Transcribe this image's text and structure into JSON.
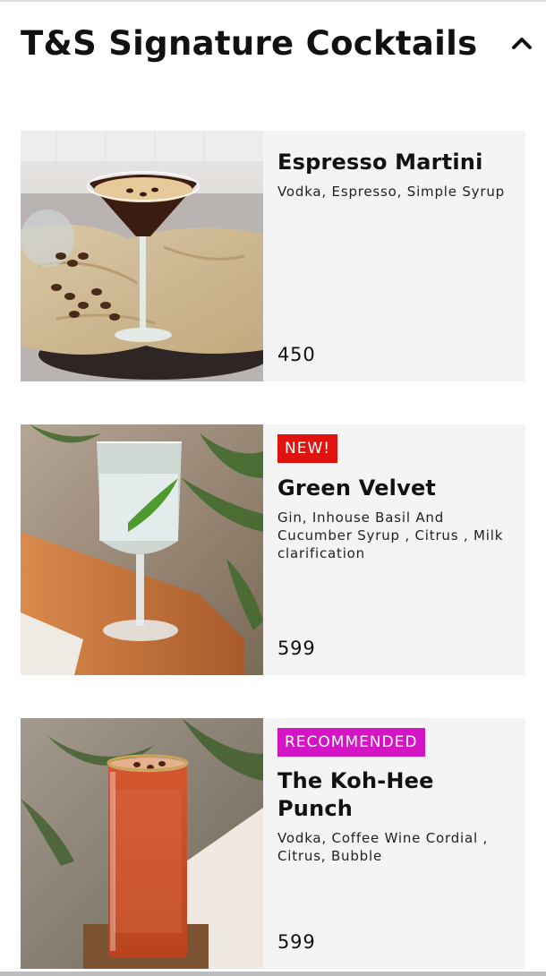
{
  "section": {
    "title": "T&S Signature Cocktails",
    "collapse_icon": "chevron-up-icon"
  },
  "items": [
    {
      "name": "Espresso Martini",
      "description": "Vodka, Espresso, Simple Syrup",
      "price": "450",
      "badge": "",
      "image": "espresso-martini-photo"
    },
    {
      "name": "Green Velvet",
      "description": "Gin, Inhouse Basil And Cucumber Syrup , Citrus , Milk clarification",
      "price": "599",
      "badge": "NEW!",
      "badge_color": "#e0130f",
      "image": "green-velvet-photo"
    },
    {
      "name": "The Koh-Hee Punch",
      "description": "Vodka, Coffee Wine Cordial , Citrus, Bubble",
      "price": "599",
      "badge": "RECOMMENDED",
      "badge_color": "#d415c4",
      "image": "koh-hee-punch-photo"
    }
  ]
}
